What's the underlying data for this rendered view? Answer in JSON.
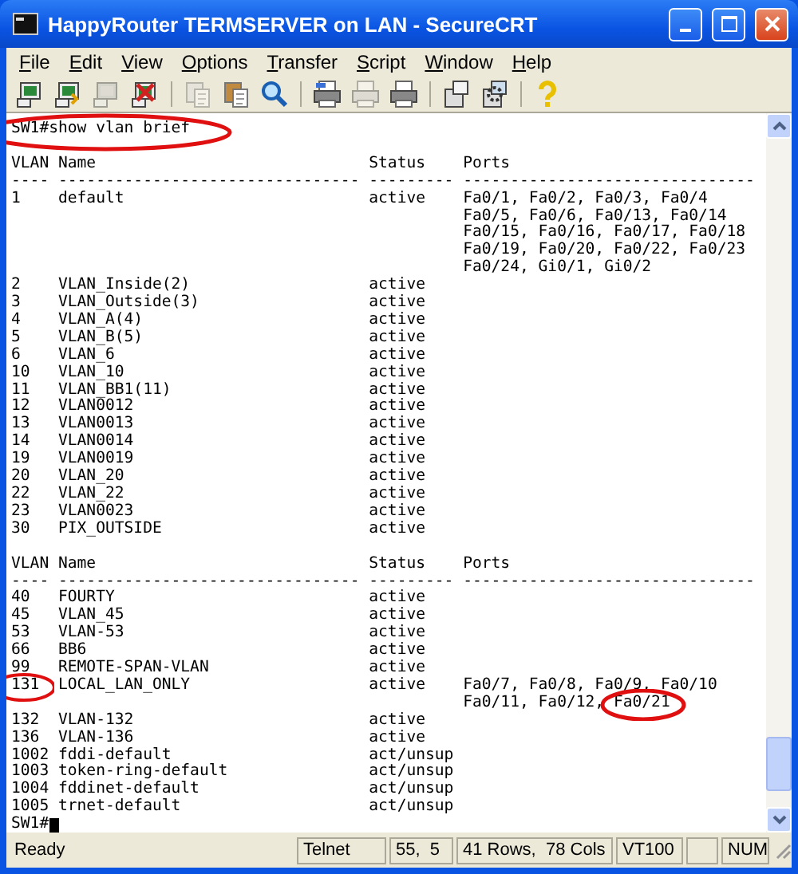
{
  "window": {
    "title": "HappyRouter TERMSERVER on LAN - SecureCRT"
  },
  "menu": [
    "File",
    "Edit",
    "View",
    "Options",
    "Transfer",
    "Script",
    "Window",
    "Help"
  ],
  "toolbar": [
    {
      "kind": "connect",
      "disabled": false
    },
    {
      "kind": "quick-connect",
      "disabled": false
    },
    {
      "kind": "reconnect",
      "disabled": true
    },
    {
      "kind": "disconnect",
      "disabled": false
    },
    {
      "kind": "sep"
    },
    {
      "kind": "copy",
      "disabled": true
    },
    {
      "kind": "paste",
      "disabled": false
    },
    {
      "kind": "find",
      "disabled": false
    },
    {
      "kind": "sep"
    },
    {
      "kind": "print-setup",
      "disabled": false
    },
    {
      "kind": "print-selection",
      "disabled": true
    },
    {
      "kind": "print",
      "disabled": false
    },
    {
      "kind": "sep"
    },
    {
      "kind": "session-options",
      "disabled": false
    },
    {
      "kind": "global-options",
      "disabled": false
    },
    {
      "kind": "sep"
    },
    {
      "kind": "help",
      "disabled": false
    }
  ],
  "terminal": {
    "command": "SW1#show vlan brief",
    "sections": [
      {
        "header": {
          "vlan": "VLAN",
          "name": "Name",
          "status": "Status",
          "ports": "Ports"
        },
        "dashes": [
          "----",
          "--------------------------------",
          "---------",
          "-------------------------------"
        ],
        "rows": [
          {
            "vlan": "1",
            "name": "default",
            "status": "active",
            "ports": [
              "Fa0/1, Fa0/2, Fa0/3, Fa0/4",
              "Fa0/5, Fa0/6, Fa0/13, Fa0/14",
              "Fa0/15, Fa0/16, Fa0/17, Fa0/18",
              "Fa0/19, Fa0/20, Fa0/22, Fa0/23",
              "Fa0/24, Gi0/1, Gi0/2"
            ]
          },
          {
            "vlan": "2",
            "name": "VLAN_Inside(2)",
            "status": "active"
          },
          {
            "vlan": "3",
            "name": "VLAN_Outside(3)",
            "status": "active"
          },
          {
            "vlan": "4",
            "name": "VLAN_A(4)",
            "status": "active"
          },
          {
            "vlan": "5",
            "name": "VLAN_B(5)",
            "status": "active"
          },
          {
            "vlan": "6",
            "name": "VLAN_6",
            "status": "active"
          },
          {
            "vlan": "10",
            "name": "VLAN_10",
            "status": "active"
          },
          {
            "vlan": "11",
            "name": "VLAN_BB1(11)",
            "status": "active"
          },
          {
            "vlan": "12",
            "name": "VLAN0012",
            "status": "active"
          },
          {
            "vlan": "13",
            "name": "VLAN0013",
            "status": "active"
          },
          {
            "vlan": "14",
            "name": "VLAN0014",
            "status": "active"
          },
          {
            "vlan": "19",
            "name": "VLAN0019",
            "status": "active"
          },
          {
            "vlan": "20",
            "name": "VLAN_20",
            "status": "active"
          },
          {
            "vlan": "22",
            "name": "VLAN_22",
            "status": "active"
          },
          {
            "vlan": "23",
            "name": "VLAN0023",
            "status": "active"
          },
          {
            "vlan": "30",
            "name": "PIX_OUTSIDE",
            "status": "active"
          }
        ]
      },
      {
        "header": {
          "vlan": "VLAN",
          "name": "Name",
          "status": "Status",
          "ports": "Ports"
        },
        "dashes": [
          "----",
          "--------------------------------",
          "---------",
          "-------------------------------"
        ],
        "rows": [
          {
            "vlan": "40",
            "name": "FOURTY",
            "status": "active"
          },
          {
            "vlan": "45",
            "name": "VLAN_45",
            "status": "active"
          },
          {
            "vlan": "53",
            "name": "VLAN-53",
            "status": "active"
          },
          {
            "vlan": "66",
            "name": "BB6",
            "status": "active"
          },
          {
            "vlan": "99",
            "name": "REMOTE-SPAN-VLAN",
            "status": "active"
          },
          {
            "vlan": "131",
            "name": "LOCAL_LAN_ONLY",
            "status": "active",
            "ports": [
              "Fa0/7, Fa0/8, Fa0/9, Fa0/10",
              "Fa0/11, Fa0/12, Fa0/21"
            ]
          },
          {
            "vlan": "132",
            "name": "VLAN-132",
            "status": "active"
          },
          {
            "vlan": "136",
            "name": "VLAN-136",
            "status": "active"
          },
          {
            "vlan": "1002",
            "name": "fddi-default",
            "status": "act/unsup"
          },
          {
            "vlan": "1003",
            "name": "token-ring-default",
            "status": "act/unsup"
          },
          {
            "vlan": "1004",
            "name": "fddinet-default",
            "status": "act/unsup"
          },
          {
            "vlan": "1005",
            "name": "trnet-default",
            "status": "act/unsup"
          }
        ]
      }
    ],
    "prompt": "SW1#"
  },
  "status_bar": [
    "Ready",
    "Telnet",
    "55,  5",
    "41 Rows,  78 Cols",
    "VT100",
    "NUM"
  ]
}
